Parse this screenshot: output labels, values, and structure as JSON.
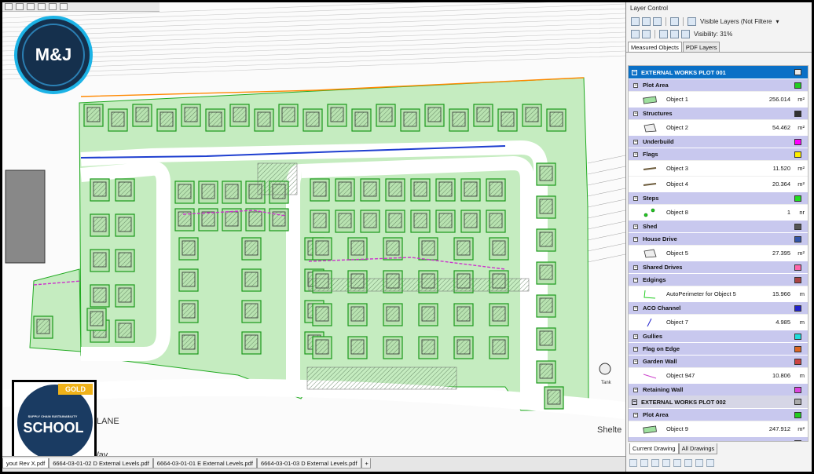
{
  "logos": {
    "mj": "M&J",
    "badge_tag": "GOLD",
    "badge_sub": "SUPPLY CHAIN SUSTAINABILITY",
    "badge_word": "SCHOOL"
  },
  "drawing": {
    "street_labels": [
      "LANE",
      "ycle Way",
      "Shelte",
      "Tank"
    ]
  },
  "doc_tabs": [
    "yout Rev X.pdf",
    "6664-03-01-02 D External Levels.pdf",
    "6664-03-01-01 E External Levels.pdf",
    "6664-03-01-03 D External Levels.pdf",
    "+"
  ],
  "panel": {
    "title": "Layer Control",
    "filter": "Visible Layers (Not Filtere",
    "visibility": "Visibility: 31%",
    "tabs": [
      "Measured Objects",
      "PDF Layers"
    ],
    "bottom_tabs": [
      "Current Drawing",
      "All Drawings"
    ],
    "plots": [
      {
        "name": "EXTERNAL WORKS PLOT 001",
        "categories": [
          {
            "label": "Plot Area",
            "color": "#22cc22",
            "objects": [
              {
                "name": "Object 1",
                "value": "256.014",
                "unit": "m²",
                "icon": "rectangle-icon"
              }
            ]
          },
          {
            "label": "Structures",
            "color": "#333333",
            "objects": [
              {
                "name": "Object 2",
                "value": "54.462",
                "unit": "m²",
                "icon": "polygon-icon"
              }
            ]
          },
          {
            "label": "Underbuild",
            "color": "#ff00ff",
            "objects": []
          },
          {
            "label": "Flags",
            "color": "#ffee00",
            "objects": [
              {
                "name": "Object 3",
                "value": "11.520",
                "unit": "m²",
                "icon": "flag-line-icon"
              },
              {
                "name": "Object 4",
                "value": "20.364",
                "unit": "m²",
                "icon": "flag-line-icon"
              }
            ]
          },
          {
            "label": "Steps",
            "color": "#22dd22",
            "objects": [
              {
                "name": "Object 8",
                "value": "1",
                "unit": "nr",
                "icon": "dots-icon"
              }
            ]
          },
          {
            "label": "Shed",
            "color": "#555555",
            "objects": []
          },
          {
            "label": "House Drive",
            "color": "#3355aa",
            "objects": [
              {
                "name": "Object 5",
                "value": "27.395",
                "unit": "m²",
                "icon": "polygon-icon"
              }
            ]
          },
          {
            "label": "Shared Drives",
            "color": "#ff66aa",
            "objects": []
          },
          {
            "label": "Edgings",
            "color": "#aa4444",
            "objects": [
              {
                "name": "AutoPerimeter for Object 5",
                "value": "15.966",
                "unit": "m",
                "icon": "perimeter-icon"
              }
            ]
          },
          {
            "label": "ACO Channel",
            "color": "#2222cc",
            "objects": [
              {
                "name": "Object 7",
                "value": "4.985",
                "unit": "m",
                "icon": "line-icon"
              }
            ]
          },
          {
            "label": "Gullies",
            "color": "#22dddd",
            "objects": []
          },
          {
            "label": "Flag on Edge",
            "color": "#dd6622",
            "objects": []
          },
          {
            "label": "Garden Wall",
            "color": "#cc4444",
            "objects": [
              {
                "name": "Object 947",
                "value": "10.806",
                "unit": "m",
                "icon": "wall-line-icon"
              }
            ]
          },
          {
            "label": "Retaining Wall",
            "color": "#dd44dd",
            "objects": []
          }
        ]
      },
      {
        "name": "EXTERNAL WORKS PLOT 002",
        "categories": [
          {
            "label": "Plot Area",
            "color": "#22cc22",
            "objects": [
              {
                "name": "Object 9",
                "value": "247.912",
                "unit": "m²",
                "icon": "rectangle-icon"
              }
            ]
          },
          {
            "label": "Structures",
            "color": "#333333",
            "objects": []
          }
        ]
      }
    ]
  }
}
